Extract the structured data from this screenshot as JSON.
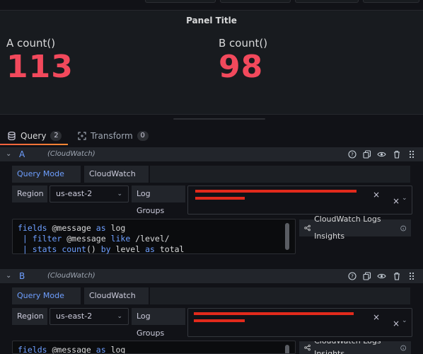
{
  "panel": {
    "title": "Panel Title",
    "stats": [
      {
        "label": "A count()",
        "value": "113"
      },
      {
        "label": "B count()",
        "value": "98"
      }
    ],
    "value_color": "#f2495c"
  },
  "tabs": [
    {
      "label": "Query",
      "count": "2",
      "active": true
    },
    {
      "label": "Transform",
      "count": "0",
      "active": false
    }
  ],
  "queries": [
    {
      "ref_id": "A",
      "datasource": "(CloudWatch)",
      "query_mode_label": "Query Mode",
      "query_mode_value": "CloudWatch Logs",
      "region_label": "Region",
      "region_value": "us-east-2",
      "log_groups_label": "Log Groups",
      "code": {
        "line1_kw1": "fields",
        "line1_txt": " @message ",
        "line1_kw2": "as",
        "line1_txt2": " log",
        "line2_pipe": " |",
        "line2_kw": " filter",
        "line2_txt": " @message ",
        "line2_kw2": "like",
        "line2_txt2": " /level/",
        "line3_pipe": " |",
        "line3_kw": " stats",
        "line3_fn": " count",
        "line3_txt": "() ",
        "line3_kw2": "by",
        "line3_txt2": " level ",
        "line3_kw3": "as",
        "line3_txt3": " total"
      },
      "insights_label": "CloudWatch Logs Insights"
    },
    {
      "ref_id": "B",
      "datasource": "(CloudWatch)",
      "query_mode_label": "Query Mode",
      "query_mode_value": "CloudWatch Logs",
      "region_label": "Region",
      "region_value": "us-east-2",
      "log_groups_label": "Log Groups",
      "code": {
        "line1_kw1": "fields",
        "line1_txt": " @message ",
        "line1_kw2": "as",
        "line1_txt2": " log"
      },
      "insights_label": "CloudWatch Logs Insights"
    }
  ],
  "icons": {
    "database": "database-icon",
    "transform": "transform-icon",
    "help": "help-icon",
    "copy": "copy-icon",
    "eye": "eye-icon",
    "trash": "trash-icon",
    "drag": "drag-handle-icon",
    "share": "share-nodes-icon",
    "info": "info-icon"
  },
  "colors": {
    "accent": "#6e9fff",
    "redaction": "#e22a1c",
    "tab_underline": "#ff8833"
  }
}
